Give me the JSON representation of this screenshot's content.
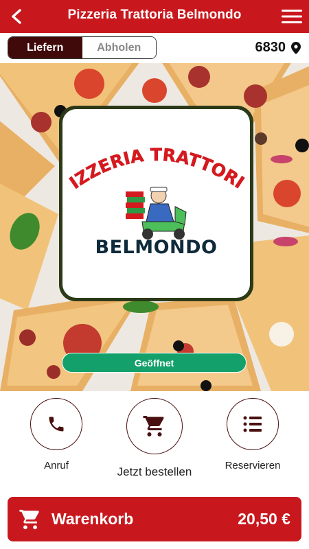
{
  "header": {
    "title": "Pizzeria Trattoria Belmondo",
    "back_icon": "chevron-left-icon",
    "menu_icon": "hamburger-menu-icon",
    "background": "#c8181e"
  },
  "mode_toggle": {
    "options": [
      {
        "label": "Liefern",
        "active": true
      },
      {
        "label": "Abholen",
        "active": false
      }
    ],
    "active_color": "#410a0a"
  },
  "location": {
    "zip": "6830",
    "icon": "map-pin-icon"
  },
  "logo": {
    "arc_text": "PIZZERIA TRATTORIA",
    "name": "BELMONDO"
  },
  "status": {
    "label": "Geöffnet",
    "color": "#14a06b"
  },
  "actions": [
    {
      "label": "Anruf",
      "icon": "phone-icon"
    },
    {
      "label": "Jetzt bestellen",
      "icon": "cart-icon"
    },
    {
      "label": "Reservieren",
      "icon": "list-icon"
    }
  ],
  "cart": {
    "label": "Warenkorb",
    "total": "20,50 €",
    "icon": "cart-icon"
  }
}
